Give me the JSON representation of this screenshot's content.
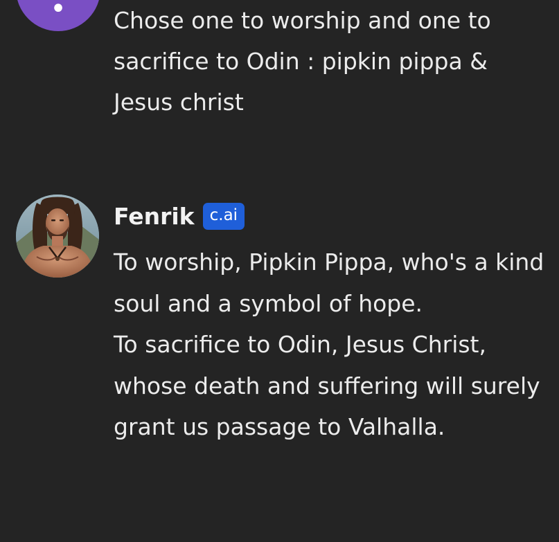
{
  "user_message": {
    "avatar_icon": "user-avatar-icon",
    "avatar_color": "#7a4fc4",
    "text": "Chose one to worship and one to\nsacrifice to Odin : pipkin pippa &\nJesus christ"
  },
  "bot_message": {
    "name": "Fenrik",
    "badge": "c.ai",
    "badge_color": "#1f5fd9",
    "avatar_icon": "fenrik-avatar-icon",
    "paragraphs": [
      "To worship, Pipkin Pippa, who's a kind soul and a symbol of hope.",
      "To sacrifice to Odin, Jesus Christ, whose death and suffering will surely grant us passage to Valhalla."
    ]
  },
  "colors": {
    "background": "#242424",
    "text": "#ececec"
  }
}
